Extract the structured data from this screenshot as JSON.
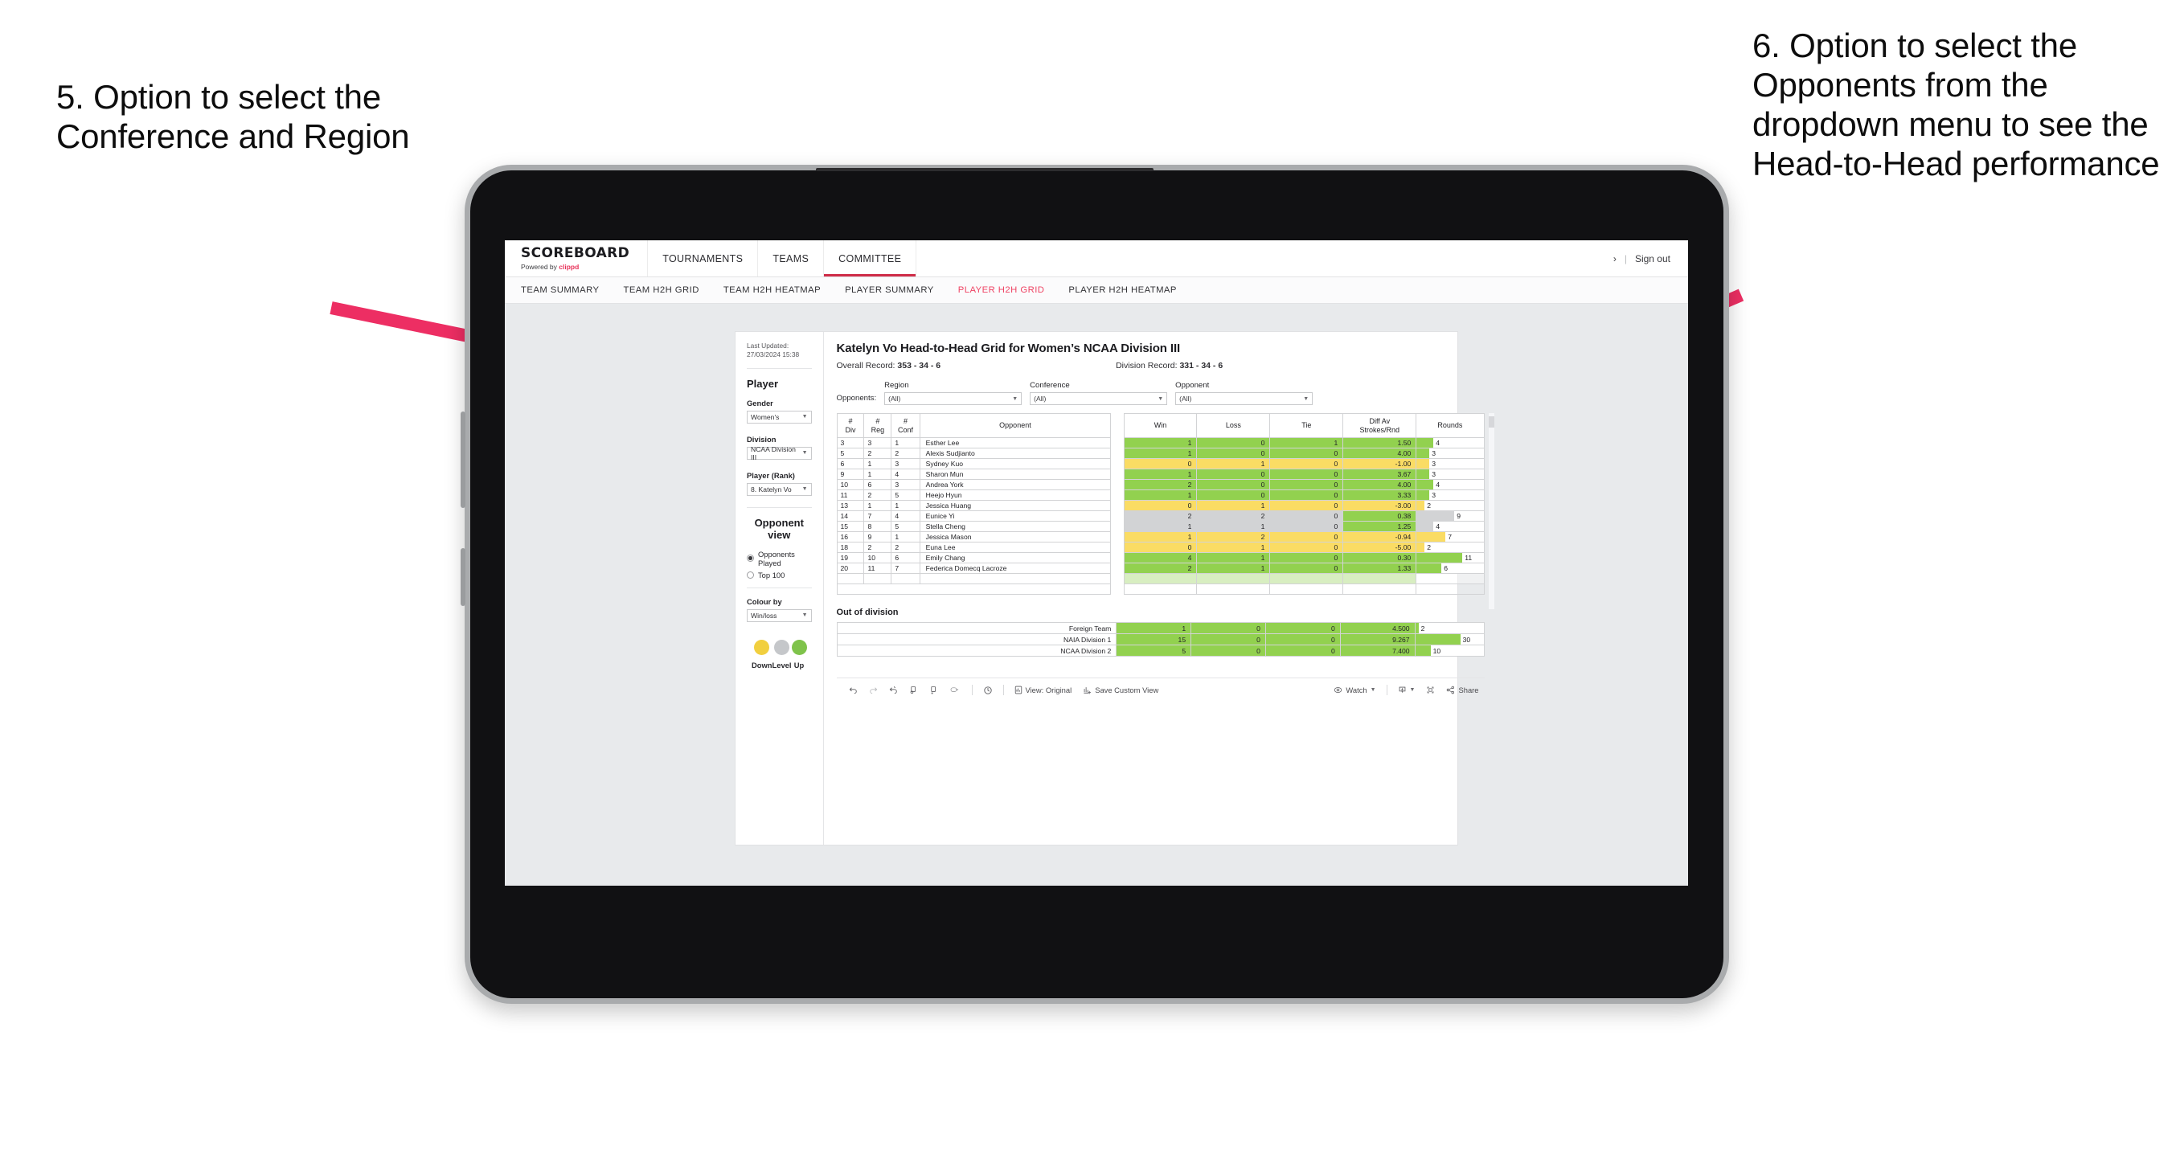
{
  "annotations": {
    "left": "5. Option to select the Conference and Region",
    "right": "6. Option to select the Opponents from the dropdown menu to see the Head-to-Head performance",
    "arrow_color": "#ed2e63"
  },
  "app": {
    "brand": {
      "title": "SCOREBOARD",
      "powered_prefix": "Powered by ",
      "powered_brand": "clippd"
    },
    "topnav": [
      {
        "label": "TOURNAMENTS",
        "active": false
      },
      {
        "label": "TEAMS",
        "active": false
      },
      {
        "label": "COMMITTEE",
        "active": true
      }
    ],
    "topbar_right": {
      "chevron": "›",
      "separator": "|",
      "sign_out": "Sign out"
    },
    "subnav": [
      {
        "label": "TEAM SUMMARY",
        "active": false
      },
      {
        "label": "TEAM H2H GRID",
        "active": false
      },
      {
        "label": "TEAM H2H HEATMAP",
        "active": false
      },
      {
        "label": "PLAYER SUMMARY",
        "active": false
      },
      {
        "label": "PLAYER H2H GRID",
        "active": true
      },
      {
        "label": "PLAYER H2H HEATMAP",
        "active": false
      }
    ]
  },
  "sidebar": {
    "last_updated": "Last Updated: 27/03/2024 15:38",
    "player_heading": "Player",
    "gender": {
      "label": "Gender",
      "value": "Women's"
    },
    "division": {
      "label": "Division",
      "value": "NCAA Division III"
    },
    "player_rank": {
      "label": "Player (Rank)",
      "value": "8. Katelyn Vo"
    },
    "opponent_view": {
      "heading": "Opponent view",
      "options": [
        {
          "label": "Opponents Played",
          "selected": true
        },
        {
          "label": "Top 100",
          "selected": false
        }
      ]
    },
    "colour_by": {
      "label": "Colour by",
      "value": "Win/loss"
    },
    "legend": [
      {
        "label": "Down",
        "color": "#f1cf3f"
      },
      {
        "label": "Level",
        "color": "#c5c7ca"
      },
      {
        "label": "Up",
        "color": "#7fc34b"
      }
    ]
  },
  "main": {
    "title": "Katelyn Vo Head-to-Head Grid for Women’s NCAA Division III",
    "overall_record_label": "Overall Record:",
    "overall_record_value": "353 - 34 - 6",
    "division_record_label": "Division Record:",
    "division_record_value": "331 - 34 - 6",
    "opponents_label": "Opponents:",
    "filters": [
      {
        "label": "Region",
        "value": "(All)"
      },
      {
        "label": "Conference",
        "value": "(All)"
      },
      {
        "label": "Opponent",
        "value": "(All)"
      }
    ]
  },
  "chart_data": {
    "type": "table",
    "title": "Katelyn Vo Head-to-Head Grid for Women’s NCAA Division III",
    "columns": [
      "# Div",
      "# Reg",
      "# Conf",
      "Opponent",
      "Win",
      "Loss",
      "Tie",
      "Diff Av Strokes/Rnd",
      "Rounds"
    ],
    "header_lines": [
      [
        "#",
        "Div"
      ],
      [
        "#",
        "Reg"
      ],
      [
        "#",
        "Conf"
      ],
      [
        "Opponent",
        ""
      ],
      [
        "Win",
        ""
      ],
      [
        "Loss",
        ""
      ],
      [
        "Tie",
        ""
      ],
      [
        "Diff Av",
        "Strokes/Rnd"
      ],
      [
        "Rounds",
        ""
      ]
    ],
    "rounds_max": 12,
    "rows": [
      {
        "div": "3",
        "reg": "3",
        "conf": "1",
        "opponent": "Esther Lee",
        "win": "1",
        "loss": "0",
        "tie": "1",
        "diff": "1.50",
        "rounds": "4",
        "state": "win",
        "diff_state": "win"
      },
      {
        "div": "5",
        "reg": "2",
        "conf": "2",
        "opponent": "Alexis Sudjianto",
        "win": "1",
        "loss": "0",
        "tie": "0",
        "diff": "4.00",
        "rounds": "3",
        "state": "win",
        "diff_state": "win"
      },
      {
        "div": "6",
        "reg": "1",
        "conf": "3",
        "opponent": "Sydney Kuo",
        "win": "0",
        "loss": "1",
        "tie": "0",
        "diff": "-1.00",
        "rounds": "3",
        "state": "lose",
        "diff_state": "lose"
      },
      {
        "div": "9",
        "reg": "1",
        "conf": "4",
        "opponent": "Sharon Mun",
        "win": "1",
        "loss": "0",
        "tie": "0",
        "diff": "3.67",
        "rounds": "3",
        "state": "win",
        "diff_state": "win"
      },
      {
        "div": "10",
        "reg": "6",
        "conf": "3",
        "opponent": "Andrea York",
        "win": "2",
        "loss": "0",
        "tie": "0",
        "diff": "4.00",
        "rounds": "4",
        "state": "win",
        "diff_state": "win"
      },
      {
        "div": "11",
        "reg": "2",
        "conf": "5",
        "opponent": "Heejo Hyun",
        "win": "1",
        "loss": "0",
        "tie": "0",
        "diff": "3.33",
        "rounds": "3",
        "state": "win",
        "diff_state": "win"
      },
      {
        "div": "13",
        "reg": "1",
        "conf": "1",
        "opponent": "Jessica Huang",
        "win": "0",
        "loss": "1",
        "tie": "0",
        "diff": "-3.00",
        "rounds": "2",
        "state": "lose",
        "diff_state": "lose"
      },
      {
        "div": "14",
        "reg": "7",
        "conf": "4",
        "opponent": "Eunice Yi",
        "win": "2",
        "loss": "2",
        "tie": "0",
        "diff": "0.38",
        "rounds": "9",
        "state": "lvl",
        "diff_state": "win"
      },
      {
        "div": "15",
        "reg": "8",
        "conf": "5",
        "opponent": "Stella Cheng",
        "win": "1",
        "loss": "1",
        "tie": "0",
        "diff": "1.25",
        "rounds": "4",
        "state": "lvl",
        "diff_state": "win"
      },
      {
        "div": "16",
        "reg": "9",
        "conf": "1",
        "opponent": "Jessica Mason",
        "win": "1",
        "loss": "2",
        "tie": "0",
        "diff": "-0.94",
        "rounds": "7",
        "state": "lose",
        "diff_state": "lose"
      },
      {
        "div": "18",
        "reg": "2",
        "conf": "2",
        "opponent": "Euna Lee",
        "win": "0",
        "loss": "1",
        "tie": "0",
        "diff": "-5.00",
        "rounds": "2",
        "state": "lose",
        "diff_state": "lose"
      },
      {
        "div": "19",
        "reg": "10",
        "conf": "6",
        "opponent": "Emily Chang",
        "win": "4",
        "loss": "1",
        "tie": "0",
        "diff": "0.30",
        "rounds": "11",
        "state": "win",
        "diff_state": "win"
      },
      {
        "div": "20",
        "reg": "11",
        "conf": "7",
        "opponent": "Federica Domecq Lacroze",
        "win": "2",
        "loss": "1",
        "tie": "0",
        "diff": "1.33",
        "rounds": "6",
        "state": "win",
        "diff_state": "win"
      }
    ],
    "out_of_division": {
      "title": "Out of division",
      "rows": [
        {
          "opponent": "Foreign Team",
          "win": "1",
          "loss": "0",
          "tie": "0",
          "diff": "4.500",
          "rounds": "2",
          "state": "win"
        },
        {
          "opponent": "NAIA Division 1",
          "win": "15",
          "loss": "0",
          "tie": "0",
          "diff": "9.267",
          "rounds": "30",
          "state": "win"
        },
        {
          "opponent": "NCAA Division 2",
          "win": "5",
          "loss": "0",
          "tie": "0",
          "diff": "7.400",
          "rounds": "10",
          "state": "win"
        }
      ],
      "rounds_max": 33
    }
  },
  "toolbar": {
    "items": [
      {
        "name": "undo-icon",
        "label": ""
      },
      {
        "name": "redo-icon",
        "label": ""
      },
      {
        "name": "revert-icon",
        "label": ""
      },
      {
        "name": "refresh-icon",
        "label": ""
      },
      {
        "name": "pause-icon",
        "label": ""
      },
      {
        "name": "highlight-icon",
        "label": ""
      }
    ],
    "view_original": "View: Original",
    "save_custom_view": "Save Custom View",
    "watch": "Watch",
    "share": "Share"
  }
}
